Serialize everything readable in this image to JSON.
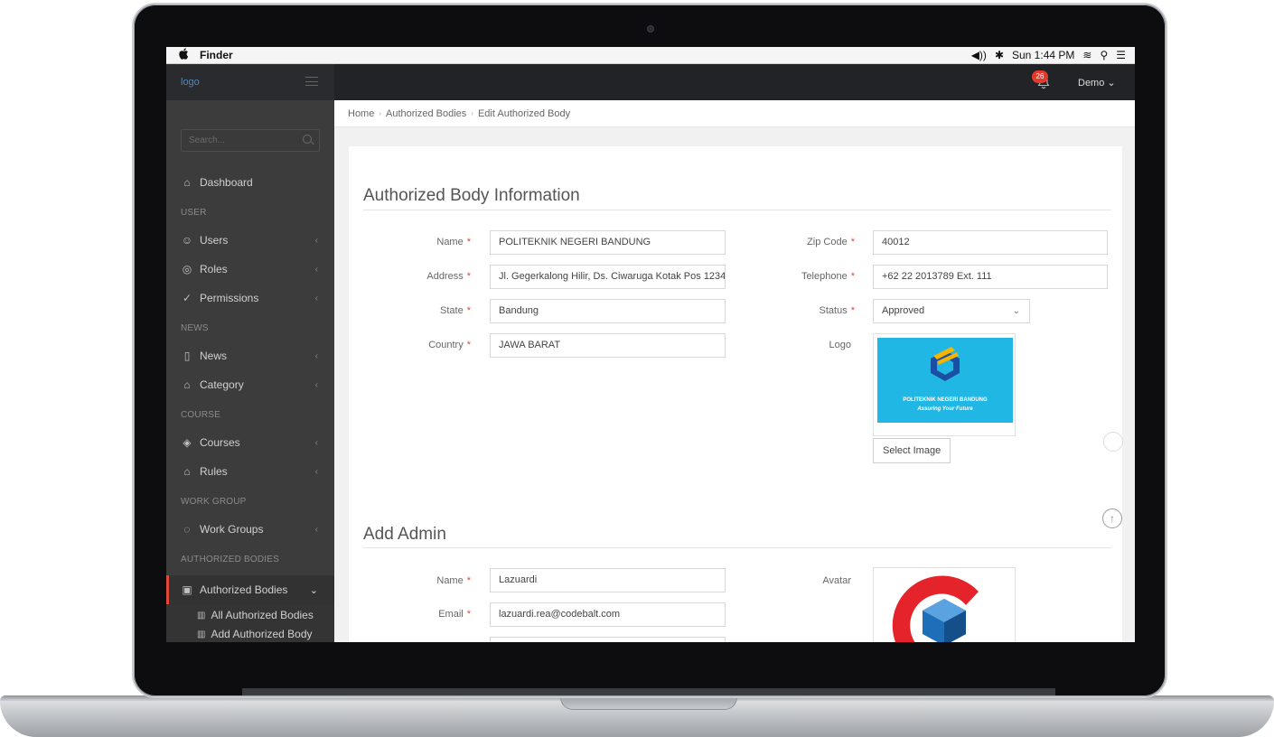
{
  "menubar": {
    "apple": "",
    "app": "Finder",
    "volume": "◀))",
    "bluetooth": "✱",
    "clock": "Sun 1:44 PM",
    "wifi": "≋",
    "spotlight": "⚲",
    "list": "☰"
  },
  "header": {
    "logo": "logo",
    "notifications": "26",
    "user": "Demo ⌄"
  },
  "sidebar": {
    "search_placeholder": "Search...",
    "sections": {
      "user": "USER",
      "news": "NEWS",
      "course": "COURSE",
      "workgroup": "WORK GROUP",
      "authorized": "AUTHORIZED BODIES"
    },
    "items": {
      "dashboard": "Dashboard",
      "users": "Users",
      "roles": "Roles",
      "permissions": "Permissions",
      "news": "News",
      "category": "Category",
      "courses": "Courses",
      "rules": "Rules",
      "work_groups": "Work Groups",
      "authorized_bodies": "Authorized Bodies",
      "all_authorized_bodies": "All Authorized Bodies",
      "add_authorized_body": "Add Authorized Body"
    },
    "chevron": "‹",
    "chevron_open": "⌄"
  },
  "breadcrumb": {
    "home": "Home",
    "sep": "›",
    "parent": "Authorized Bodies",
    "current": "Edit Authorized Body"
  },
  "info": {
    "title": "Authorized Body Information",
    "name_label": "Name",
    "name_value": "POLITEKNIK NEGERI BANDUNG",
    "address_label": "Address",
    "address_value": "Jl. Gegerkalong Hilir, Ds. Ciwaruga Kotak Pos 1234",
    "state_label": "State",
    "state_value": "Bandung",
    "country_label": "Country",
    "country_value": "JAWA BARAT",
    "zip_label": "Zip Code",
    "zip_value": "40012",
    "telephone_label": "Telephone",
    "telephone_value": "+62 22 2013789 Ext. 111",
    "status_label": "Status",
    "status_value": "Approved",
    "logo_label": "Logo",
    "logo_caption_1": "POLITEKNIK NEGERI BANDUNG",
    "logo_caption_2": "Assuring Your Future",
    "select_image": "Select Image",
    "required_mark": "*"
  },
  "admin": {
    "title": "Add Admin",
    "name_label": "Name",
    "name_value": "Lazuardi",
    "email_label": "Email",
    "email_value": "lazuardi.rea@codebalt.com",
    "avatar_label": "Avatar"
  },
  "controls": {
    "scroll_up": "↑"
  },
  "colors": {
    "accent": "#e0493c",
    "sidebar": "#3c3c3c",
    "header": "#222326",
    "link": "#3a8edb"
  }
}
